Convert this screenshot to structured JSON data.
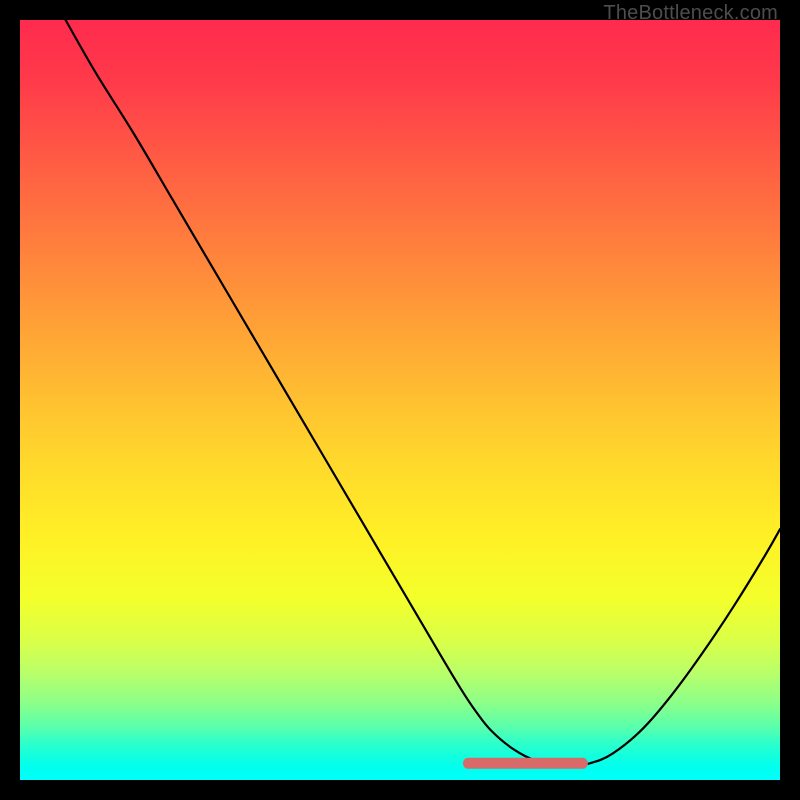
{
  "watermark": {
    "text": "TheBottleneck.com"
  },
  "chart_data": {
    "type": "line",
    "title": "",
    "xlabel": "",
    "ylabel": "",
    "xlim": [
      0,
      100
    ],
    "ylim": [
      0,
      100
    ],
    "grid": false,
    "legend": false,
    "note": "y ≈ bottleneck %; values read/estimated from the curve against the gradient (0=bottom/green, 100=top/red)",
    "series": [
      {
        "name": "bottleneck-curve",
        "x": [
          6,
          10,
          15,
          20,
          25,
          30,
          35,
          40,
          45,
          50,
          55,
          58,
          60,
          62,
          65,
          68,
          71,
          73,
          75,
          78,
          82,
          86,
          90,
          94,
          98,
          100
        ],
        "y": [
          100,
          93,
          85,
          76.5,
          68,
          59.5,
          51,
          42.5,
          34,
          25.5,
          17,
          12,
          9,
          6.5,
          4,
          2.5,
          2,
          2,
          2.2,
          3.5,
          6.8,
          11.5,
          17,
          23,
          29.5,
          33
        ]
      }
    ],
    "highlight": {
      "name": "flat-minimum-segment",
      "color": "#d86a6a",
      "x": [
        59,
        74
      ],
      "y": [
        2.2,
        2.2
      ]
    }
  }
}
